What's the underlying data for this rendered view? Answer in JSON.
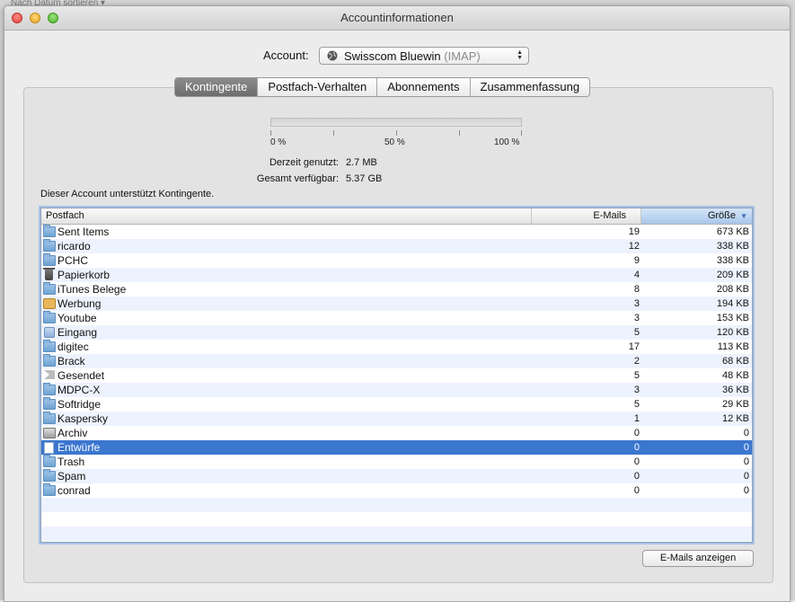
{
  "background": {
    "hint_text": "Nach Datum sortieren ▾"
  },
  "window": {
    "title": "Accountinformationen"
  },
  "account": {
    "label": "Account:",
    "name": "Swisscom Bluewin",
    "type": "(IMAP)"
  },
  "tabs": [
    {
      "label": "Kontingente",
      "selected": true
    },
    {
      "label": "Postfach-Verhalten",
      "selected": false
    },
    {
      "label": "Abonnements",
      "selected": false
    },
    {
      "label": "Zusammenfassung",
      "selected": false
    }
  ],
  "quota": {
    "used_fraction": 0.0,
    "tick_labels": [
      "0 %",
      "50 %",
      "100 %"
    ],
    "used_label": "Derzeit genutzt:",
    "used_value": "2.7 MB",
    "total_label": "Gesamt verfügbar:",
    "total_value": "5.37 GB",
    "support_text": "Dieser Account unterstützt Kontingente."
  },
  "table": {
    "headers": {
      "name": "Postfach",
      "count": "E-Mails",
      "size": "Größe"
    },
    "rows": [
      {
        "name": "Sent Items",
        "count": "19",
        "size": "673 KB",
        "icon": "folder-icon"
      },
      {
        "name": "ricardo",
        "count": "12",
        "size": "338 KB",
        "icon": "folder-icon"
      },
      {
        "name": "PCHC",
        "count": "9",
        "size": "338 KB",
        "icon": "folder-icon"
      },
      {
        "name": "Papierkorb",
        "count": "4",
        "size": "209 KB",
        "icon": "trash-icon"
      },
      {
        "name": "iTunes Belege",
        "count": "8",
        "size": "208 KB",
        "icon": "folder-icon"
      },
      {
        "name": "Werbung",
        "count": "3",
        "size": "194 KB",
        "icon": "junk-icon"
      },
      {
        "name": "Youtube",
        "count": "3",
        "size": "153 KB",
        "icon": "folder-icon"
      },
      {
        "name": "Eingang",
        "count": "5",
        "size": "120 KB",
        "icon": "inbox-icon"
      },
      {
        "name": "digitec",
        "count": "17",
        "size": "113 KB",
        "icon": "folder-icon"
      },
      {
        "name": "Brack",
        "count": "2",
        "size": "68 KB",
        "icon": "folder-icon"
      },
      {
        "name": "Gesendet",
        "count": "5",
        "size": "48 KB",
        "icon": "sent-icon"
      },
      {
        "name": "MDPC-X",
        "count": "3",
        "size": "36 KB",
        "icon": "folder-icon"
      },
      {
        "name": "Softridge",
        "count": "5",
        "size": "29 KB",
        "icon": "folder-icon"
      },
      {
        "name": "Kaspersky",
        "count": "1",
        "size": "12 KB",
        "icon": "folder-icon"
      },
      {
        "name": "Archiv",
        "count": "0",
        "size": "0",
        "icon": "archive-icon"
      },
      {
        "name": "Entwürfe",
        "count": "0",
        "size": "0",
        "icon": "draft-icon",
        "selected": true
      },
      {
        "name": "Trash",
        "count": "0",
        "size": "0",
        "icon": "folder-icon"
      },
      {
        "name": "Spam",
        "count": "0",
        "size": "0",
        "icon": "folder-icon"
      },
      {
        "name": "conrad",
        "count": "0",
        "size": "0",
        "icon": "folder-icon"
      }
    ],
    "empty_rows": 3
  },
  "buttons": {
    "show_mails": "E-Mails anzeigen"
  },
  "colors": {
    "selection": "#3b76cf",
    "alt_row": "#edf3fe"
  }
}
